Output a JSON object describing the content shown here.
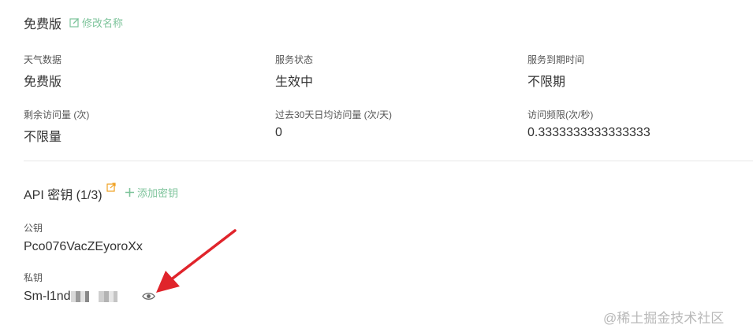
{
  "plan": {
    "name": "免费版",
    "edit_label": "修改名称"
  },
  "info": {
    "row1": [
      {
        "label": "天气数据",
        "value": "免费版"
      },
      {
        "label": "服务状态",
        "value": "生效中"
      },
      {
        "label": "服务到期时间",
        "value": "不限期"
      }
    ],
    "row2": [
      {
        "label": "剩余访问量 (次)",
        "value": "不限量"
      },
      {
        "label": "过去30天日均访问量 (次/天)",
        "value": "0"
      },
      {
        "label": "访问频限(次/秒)",
        "value": "0.3333333333333333"
      }
    ]
  },
  "api": {
    "title": "API 密钥 (1/3)",
    "add_label": "添加密钥",
    "public_key_label": "公钥",
    "public_key": "Pco076VacZEyoroXx",
    "private_key_label": "私钥",
    "private_key_visible": "Sm-l1nd"
  },
  "watermark": "@稀土掘金技术社区",
  "colors": {
    "accent_green": "#7cc39a",
    "external_link_orange": "#f0a020",
    "arrow_red": "#e0242b"
  }
}
